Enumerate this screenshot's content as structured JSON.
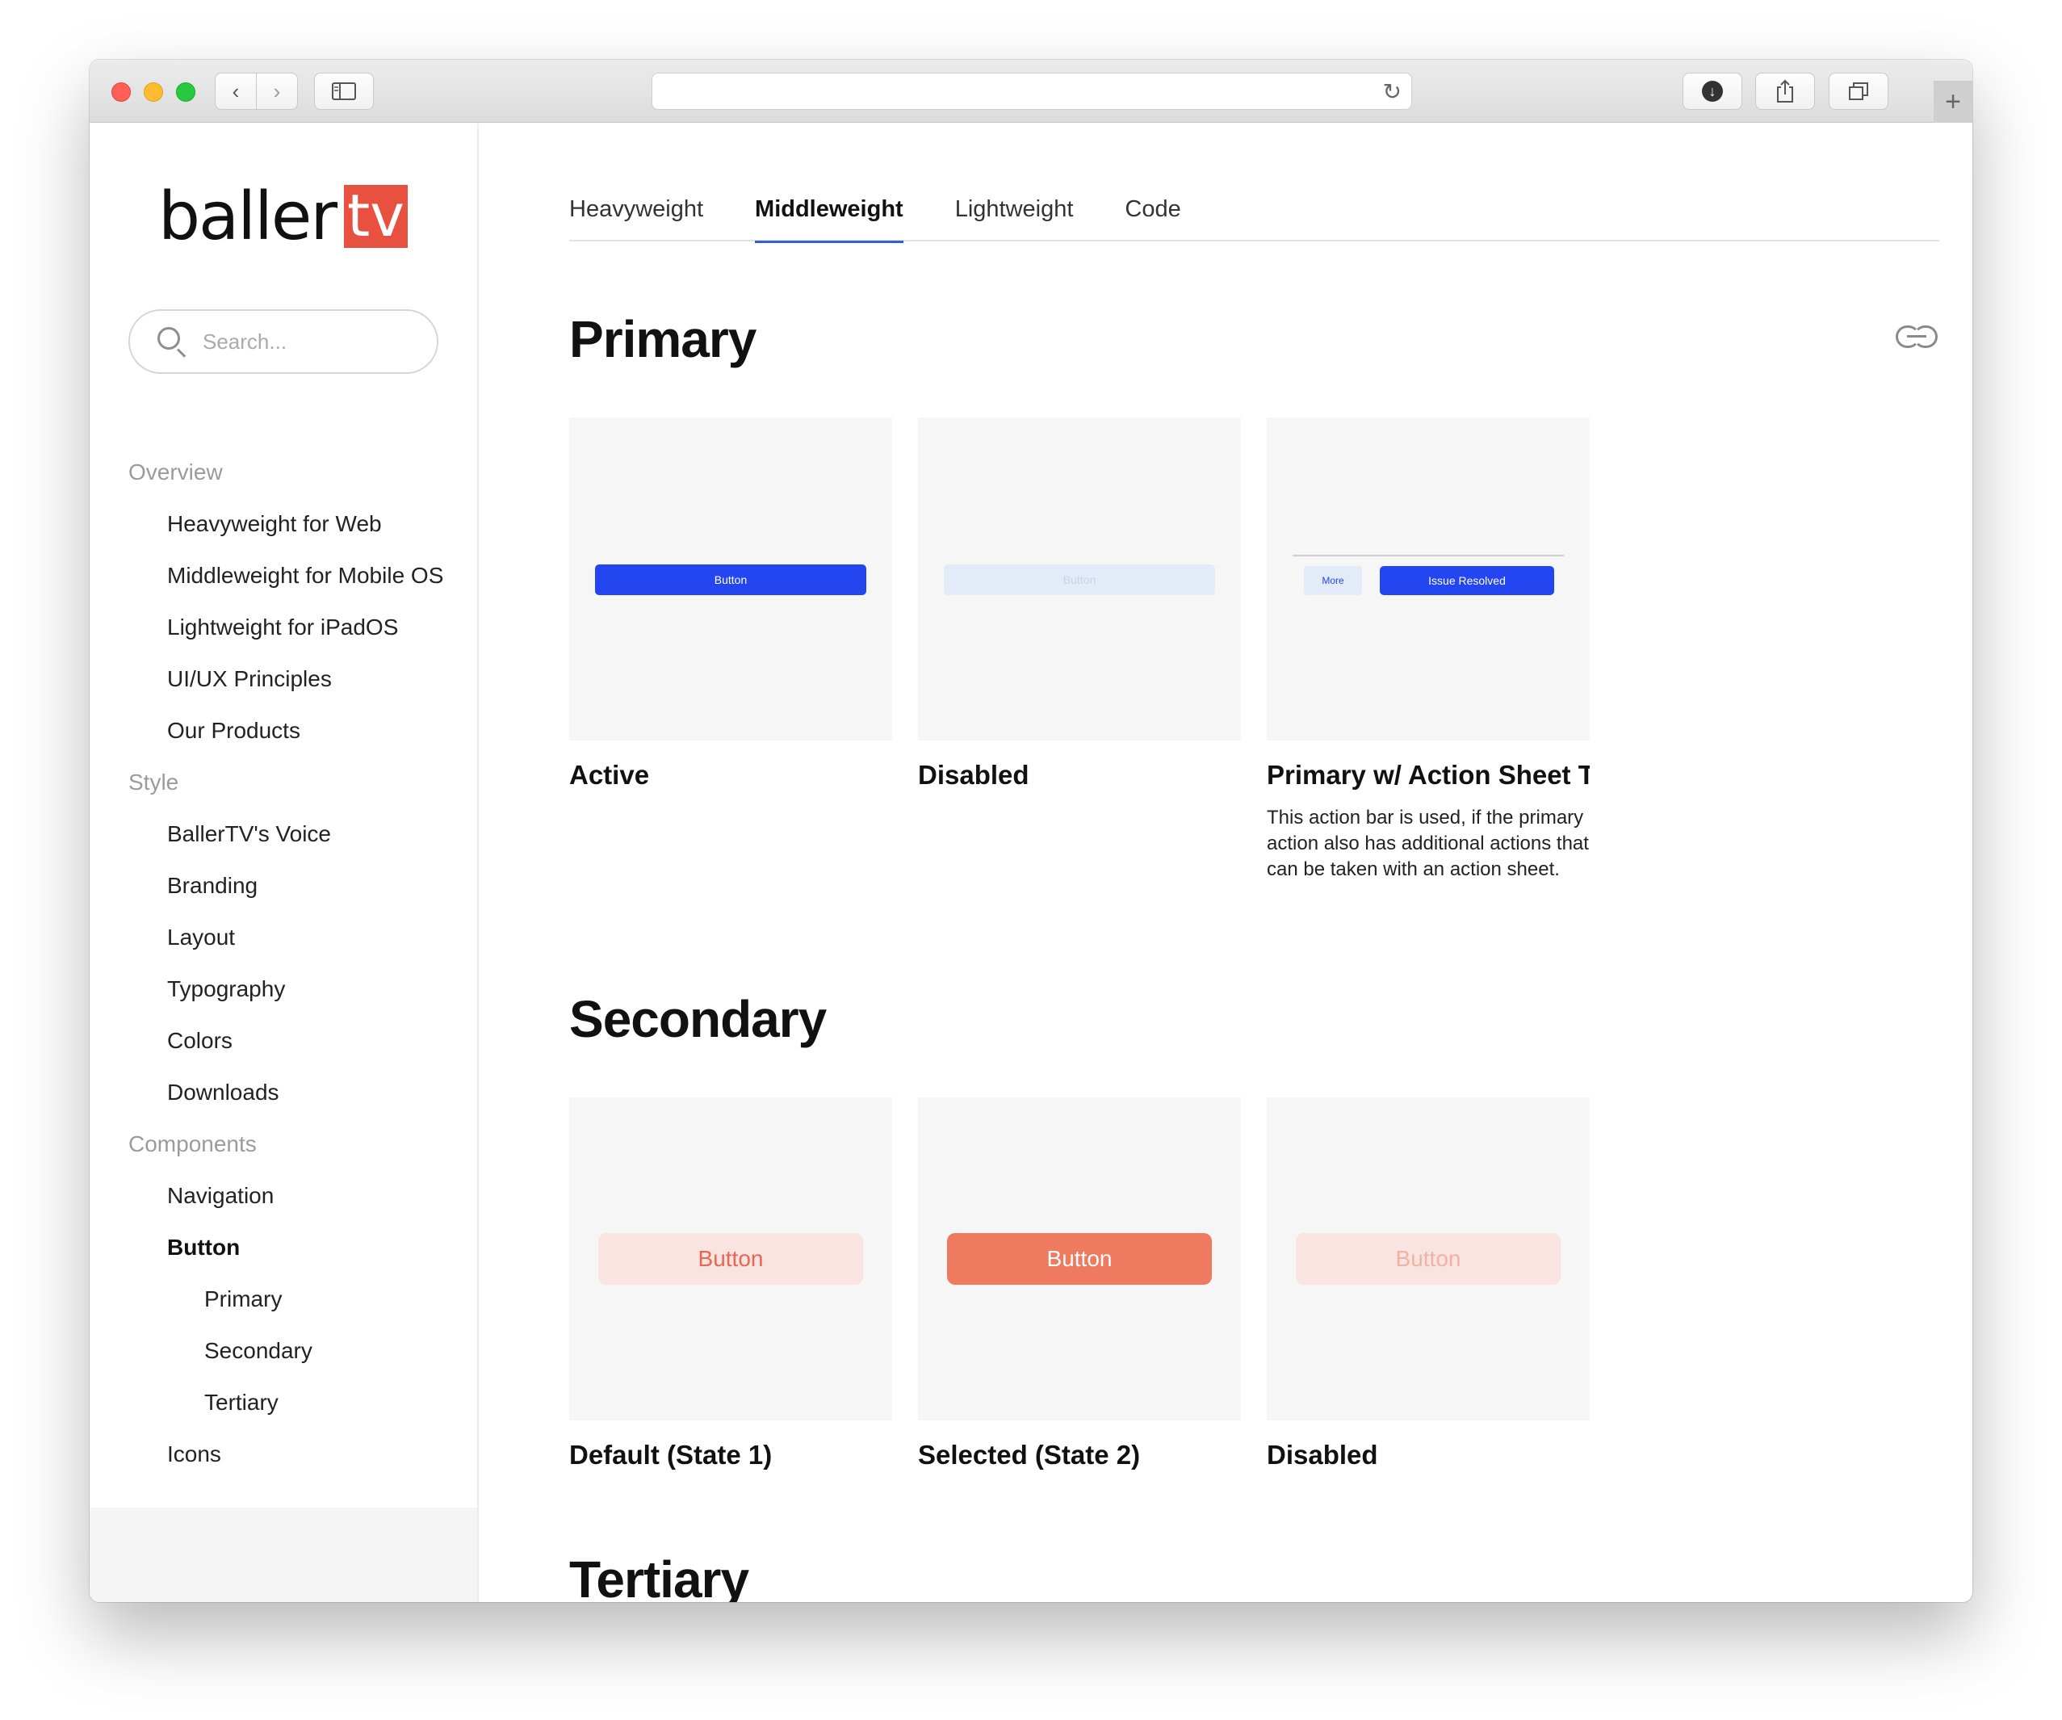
{
  "browser": {
    "back_icon": "‹",
    "forward_icon": "›",
    "reload_icon": "↻",
    "new_tab_icon": "+"
  },
  "sidebar": {
    "logo": {
      "part1": "baller",
      "part2": "tv",
      "accent_color": "#e8503f"
    },
    "search": {
      "placeholder": "Search..."
    },
    "sections": [
      {
        "title": "Overview",
        "items": [
          "Heavyweight for Web",
          "Middleweight for Mobile OS",
          "Lightweight for iPadOS",
          "UI/UX Principles",
          "Our Products"
        ]
      },
      {
        "title": "Style",
        "items": [
          "BallerTV's Voice",
          "Branding",
          "Layout",
          "Typography",
          "Colors",
          "Downloads"
        ]
      },
      {
        "title": "Components",
        "items": [
          "Navigation",
          "Button"
        ],
        "sub_items": [
          "Primary",
          "Secondary",
          "Tertiary"
        ],
        "more": "Icons"
      }
    ],
    "active_item": "Button"
  },
  "main": {
    "tabs": [
      "Heavyweight",
      "Middleweight",
      "Lightweight",
      "Code"
    ],
    "active_tab": "Middleweight",
    "primary": {
      "title": "Primary",
      "cards": [
        {
          "label": "Active",
          "button": "Button"
        },
        {
          "label": "Disabled",
          "button": "Button"
        },
        {
          "label": "Primary w/ Action Sheet T",
          "more": "More",
          "button": "Issue Resolved",
          "desc": "This action bar is used, if the primary action also has additional actions that can be taken with an action sheet."
        }
      ]
    },
    "secondary": {
      "title": "Secondary",
      "cards": [
        {
          "label": "Default (State 1)",
          "button": "Button"
        },
        {
          "label": "Selected (State 2)",
          "button": "Button"
        },
        {
          "label": "Disabled",
          "button": "Button"
        }
      ]
    },
    "tertiary": {
      "title": "Tertiary"
    }
  },
  "colors": {
    "primary_blue": "#2346f0",
    "secondary_coral": "#ee7a60",
    "tab_underline": "#2f5fd9"
  }
}
